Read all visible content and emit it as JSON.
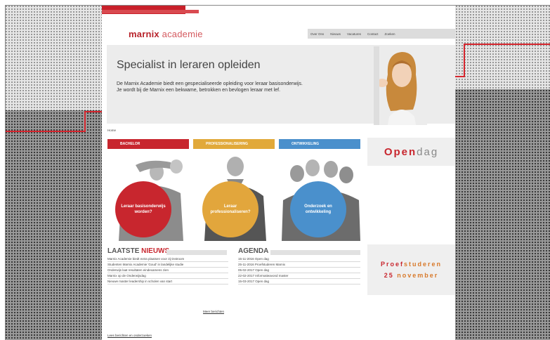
{
  "logo": {
    "part1": "marnix",
    "part2": " academie"
  },
  "topnav": {
    "items": [
      "Over Ons",
      "Nieuws",
      "Vacatures",
      "Contact",
      "Zoeken"
    ]
  },
  "hero": {
    "title": "Specialist in leraren opleiden",
    "text_line1": "De Marnix Academie biedt een gespecialiseerde opleiding voor leraar basisonderwijs.",
    "text_line2": "Je wordt bij de Marnix een bekwame, betrokken en bevlogen leraar met lef."
  },
  "breadcrumb": "Home",
  "categories": [
    {
      "label": "BACHELOR",
      "circle": "Leraar basisonderwijs worden?",
      "color": "#c8262e"
    },
    {
      "label": "PROFESSIONALISERING",
      "circle": "Leraar professionaliseren?",
      "color": "#e2a63c"
    },
    {
      "label": "ONTWIKKELING",
      "circle": "Onderzoek en ontwikkeling",
      "color": "#4a90cc"
    }
  ],
  "news": {
    "title_part1": "LAATSTE ",
    "title_part2": "NIEUWS",
    "items": [
      "Marnix Academie biedt extra plaatsen voor zij-instroom",
      "Studenten Marnix Academie 'Goud' in landelijke studie",
      "Onderwijs laat resultaten eindexamens zien",
      "Marnix op de Onderwijsdag",
      "Nieuwe master leadership in scholen van start"
    ]
  },
  "agenda": {
    "title": "AGENDA",
    "items": [
      "15-11-2016 Open dag",
      "25-11-2016 Proefstuderen Marnix",
      "05-02-2017 Open dag",
      "22-02-2017 Informatieavond master",
      "15-03-2017 Open dag"
    ]
  },
  "more_link": "Meer berichten",
  "footer_link": "Lees berichten en onderzoeken",
  "open_dag": {
    "red": "Open",
    "grey": " dag"
  },
  "proef": {
    "red": "Proef",
    "orange": "studeren",
    "date_num": "25",
    "date_month": " november"
  },
  "colors": {
    "brand_red": "#c8262e",
    "orange": "#e2a63c",
    "blue": "#4a90cc"
  }
}
